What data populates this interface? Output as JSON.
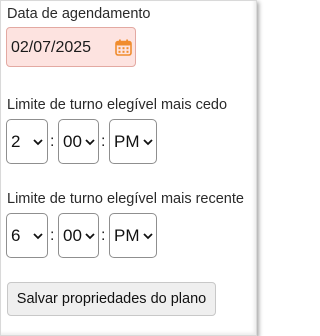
{
  "scheduling_date": {
    "label": "Data de agendamento",
    "value": "02/07/2025",
    "icon": "calendar-icon",
    "accent_color": "#f08c2e",
    "field_bg": "#fde3e0"
  },
  "earliest_shift": {
    "label": "Limite de turno elegível mais cedo",
    "hour": "2",
    "minute": "00",
    "period": "PM",
    "separator": ":"
  },
  "latest_shift": {
    "label": "Limite de turno elegível mais recente",
    "hour": "6",
    "minute": "00",
    "period": "PM",
    "separator": ":"
  },
  "save_button": {
    "label": "Salvar propriedades do plano"
  }
}
